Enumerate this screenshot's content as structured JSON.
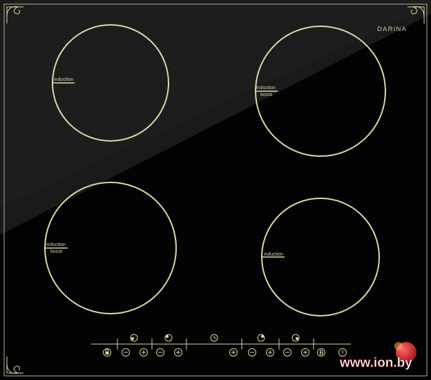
{
  "brand": "DARINA",
  "zones": [
    {
      "id": "front-left",
      "labels": [
        "induction"
      ]
    },
    {
      "id": "rear-right",
      "labels": [
        "induction",
        "boost"
      ]
    },
    {
      "id": "rear-left",
      "labels": [
        "induction",
        "boost"
      ]
    },
    {
      "id": "front-right",
      "labels": [
        "induction"
      ]
    }
  ],
  "watermark": "www.ion.by",
  "colors": {
    "glass": "#050505",
    "trim": "#e2d6a4",
    "watermark_accent": "#d7262f"
  },
  "controls": [
    "lock-icon",
    "minus-icon",
    "plus-icon",
    "minus-icon",
    "plus-icon",
    "timer-icon",
    "plus-icon",
    "minus-icon",
    "plus-icon",
    "minus-icon",
    "plus-icon",
    "boost-b-icon",
    "power-icon"
  ]
}
